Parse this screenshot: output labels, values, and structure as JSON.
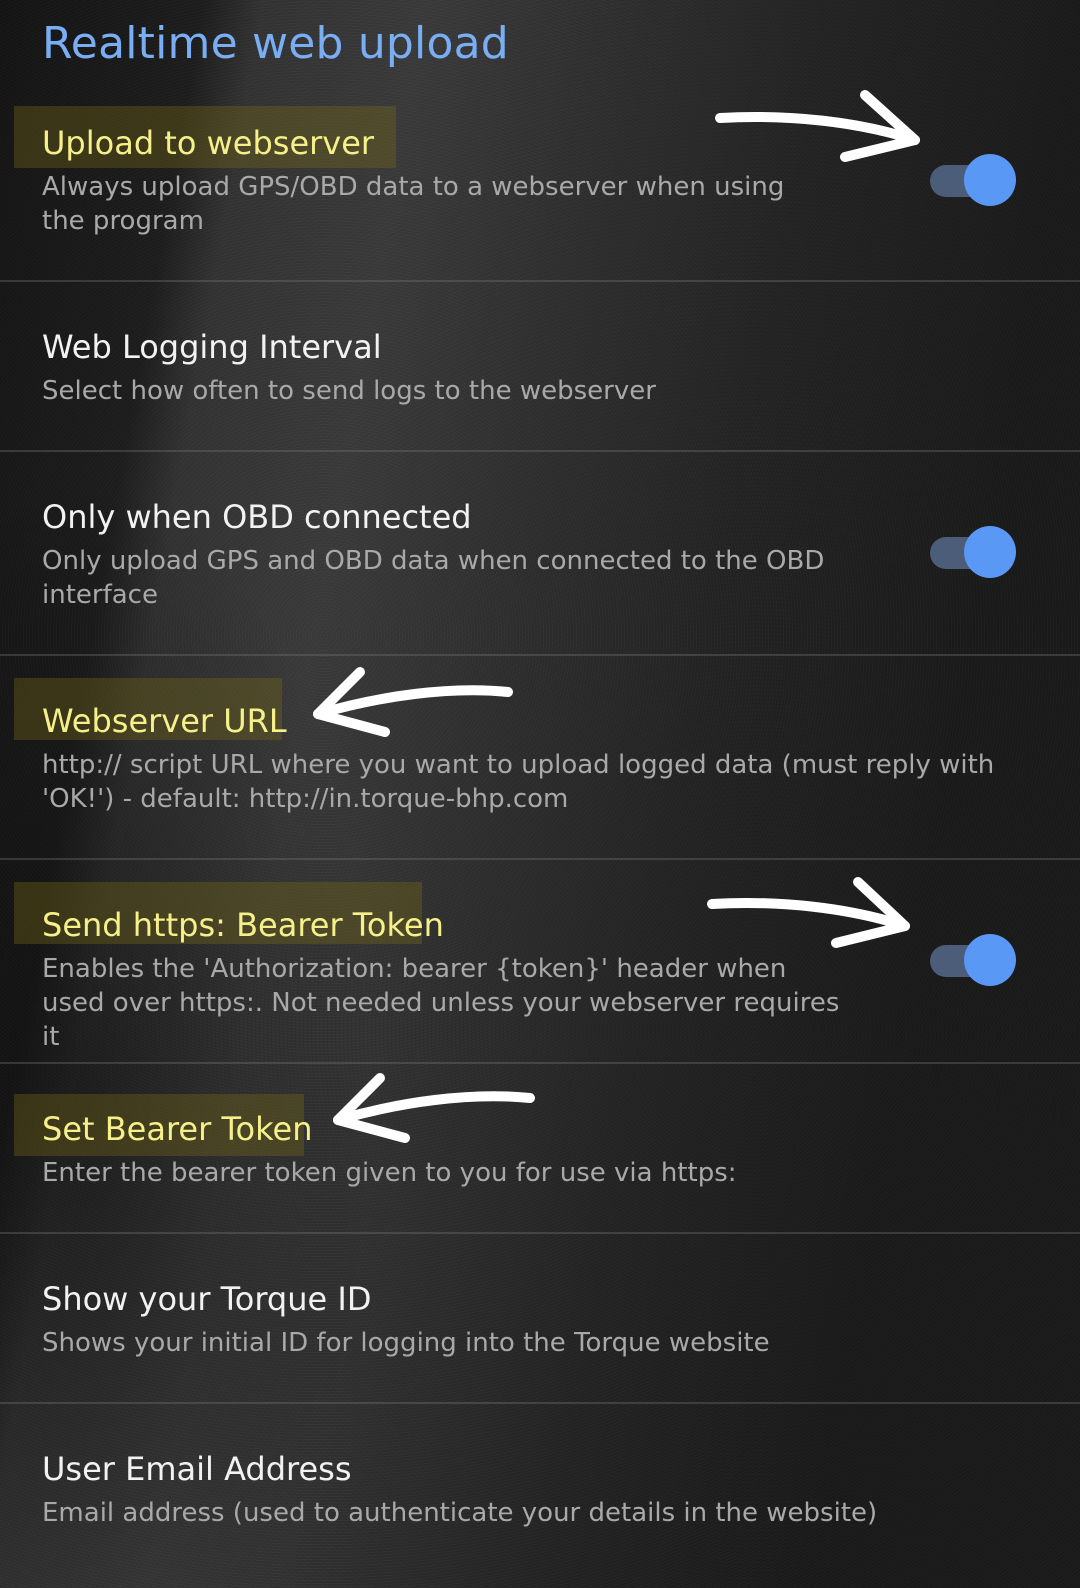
{
  "header": {
    "title": "Realtime web upload"
  },
  "accent_color": "#79aef5",
  "highlight_text_color": "#f6f08a",
  "settings": [
    {
      "title": "Upload to webserver",
      "summary": "Always upload GPS/OBD data to a webserver when using the program",
      "control": "switch",
      "checked": true,
      "highlighted": true
    },
    {
      "title": "Web Logging Interval",
      "summary": "Select how often to send logs to the webserver",
      "control": "none",
      "highlighted": false
    },
    {
      "title": "Only when OBD connected",
      "summary": "Only upload GPS and OBD data when connected to the OBD interface",
      "control": "switch",
      "checked": true,
      "highlighted": false
    },
    {
      "title": "Webserver URL",
      "summary": "http:// script URL where you want to upload logged data (must reply with 'OK!') - default: http://in.torque-bhp.com",
      "control": "none",
      "highlighted": true
    },
    {
      "title": "Send https: Bearer Token",
      "summary": "Enables the 'Authorization: bearer {token}' header when used over https:. Not needed unless your webserver requires it",
      "control": "switch",
      "checked": true,
      "highlighted": true
    },
    {
      "title": "Set Bearer Token",
      "summary": "Enter the bearer token given to you for use via https:",
      "control": "none",
      "highlighted": true
    },
    {
      "title": "Show your Torque ID",
      "summary": "Shows your initial ID for logging into the Torque website",
      "control": "none",
      "highlighted": false
    },
    {
      "title": "User Email Address",
      "summary": "Email address (used to authenticate your details in the website)",
      "control": "none",
      "highlighted": false
    }
  ],
  "annotations": {
    "arrow_icon": "hand-drawn-arrow-icon"
  }
}
